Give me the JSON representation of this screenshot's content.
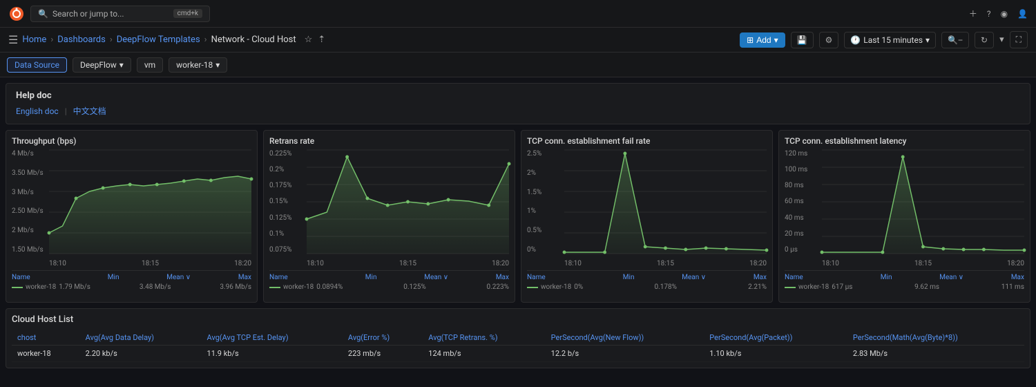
{
  "topbar": {
    "search_placeholder": "Search or jump to...",
    "shortcut": "cmd+k",
    "add_label": "Add",
    "plus_icon": "+",
    "help_icon": "?",
    "rss_icon": "rss",
    "user_icon": "user"
  },
  "breadcrumb": {
    "home": "Home",
    "dashboards": "Dashboards",
    "deepflow_templates": "DeepFlow Templates",
    "current": "Network - Cloud Host"
  },
  "toolbar": {
    "time_range": "Last 15 minutes",
    "add_label": "Add"
  },
  "filters": {
    "data_source_label": "Data Source",
    "deepflow_label": "DeepFlow",
    "vm_label": "vm",
    "worker18_label": "worker-18"
  },
  "help": {
    "title": "Help doc",
    "english_label": "English doc",
    "chinese_label": "中文文档"
  },
  "charts": [
    {
      "title": "Throughput (bps)",
      "y_labels": [
        "4 Mb/s",
        "3.50 Mb/s",
        "3 Mb/s",
        "2.50 Mb/s",
        "2 Mb/s",
        "1.50 Mb/s"
      ],
      "x_labels": [
        "18:10",
        "18:15",
        "18:20"
      ],
      "legend_cols": [
        "Name",
        "Min",
        "Mean ∨",
        "Max"
      ],
      "legend_name": "worker-18",
      "legend_values": [
        "1.79 Mb/s",
        "3.48 Mb/s",
        "3.96 Mb/s"
      ]
    },
    {
      "title": "Retrans rate",
      "y_labels": [
        "0.225%",
        "0.2%",
        "0.175%",
        "0.15%",
        "0.125%",
        "0.1%",
        "0.075%"
      ],
      "x_labels": [
        "18:10",
        "18:15",
        "18:20"
      ],
      "legend_cols": [
        "Name",
        "Min",
        "Mean ∨",
        "Max"
      ],
      "legend_name": "worker-18",
      "legend_values": [
        "0.0894%",
        "0.125%",
        "0.223%"
      ]
    },
    {
      "title": "TCP conn. establishment fail rate",
      "y_labels": [
        "2.5%",
        "2%",
        "1.5%",
        "1%",
        "0.5%",
        "0%"
      ],
      "x_labels": [
        "18:10",
        "18:15",
        "18:20"
      ],
      "legend_cols": [
        "Name",
        "Min",
        "Mean ∨",
        "Max"
      ],
      "legend_name": "worker-18",
      "legend_values": [
        "0%",
        "0.178%",
        "2.21%"
      ]
    },
    {
      "title": "TCP conn. establishment latency",
      "y_labels": [
        "120 ms",
        "100 ms",
        "80 ms",
        "60 ms",
        "40 ms",
        "20 ms",
        "0 µs"
      ],
      "x_labels": [
        "18:10",
        "18:15",
        "18:20"
      ],
      "legend_cols": [
        "Name",
        "Min",
        "Mean ∨",
        "Max"
      ],
      "legend_name": "worker-18",
      "legend_values": [
        "617 µs",
        "9.62 ms",
        "111 ms"
      ]
    }
  ],
  "cloud_host_table": {
    "title": "Cloud Host List",
    "columns": [
      "chost",
      "Avg(Avg Data Delay)",
      "Avg(Avg TCP Est. Delay)",
      "Avg(Error %)",
      "Avg(TCP Retrans. %)",
      "PerSecond(Avg(New Flow))",
      "PerSecond(Avg(Packet))",
      "PerSecond(Math(Avg(Byte)*8))"
    ],
    "rows": [
      [
        "worker-18",
        "2.20 kb/s",
        "11.9 kb/s",
        "223 mb/s",
        "124 mb/s",
        "12.2 b/s",
        "1.10 kb/s",
        "2.83 Mb/s"
      ]
    ]
  }
}
